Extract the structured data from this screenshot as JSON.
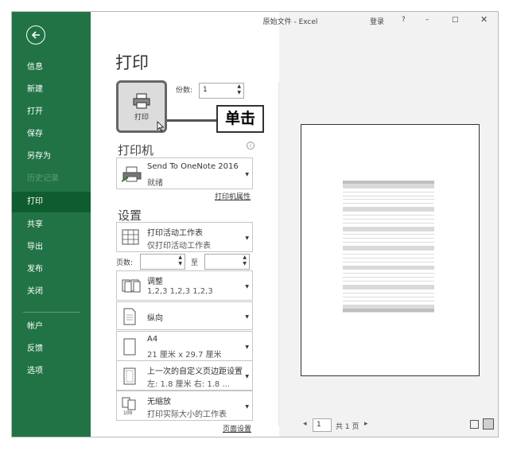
{
  "window": {
    "title": "原始文件 - Excel",
    "sign_in": "登录",
    "help": "?",
    "minimize": "–",
    "maximize": "□",
    "close": "✕"
  },
  "sidebar": {
    "items": [
      {
        "label": "信息"
      },
      {
        "label": "新建"
      },
      {
        "label": "打开"
      },
      {
        "label": "保存"
      },
      {
        "label": "另存为"
      },
      {
        "label": "历史记录"
      },
      {
        "label": "打印"
      },
      {
        "label": "共享"
      },
      {
        "label": "导出"
      },
      {
        "label": "发布"
      },
      {
        "label": "关闭"
      },
      {
        "label": "帐户"
      },
      {
        "label": "反馈"
      },
      {
        "label": "选项"
      }
    ]
  },
  "print": {
    "title": "打印",
    "button_label": "打印",
    "copies_label": "份数:",
    "copies_value": "1",
    "callout": "单击"
  },
  "printer": {
    "section_title": "打印机",
    "name": "Send To OneNote 2016",
    "status": "就绪",
    "properties_link": "打印机属性"
  },
  "settings": {
    "section_title": "设置",
    "scope_line1": "打印活动工作表",
    "scope_line2": "仅打印活动工作表",
    "pages_label": "页数:",
    "to_label": "至",
    "collate_line1": "调整",
    "collate_line2": "1,2,3    1,2,3    1,2,3",
    "orientation": "纵向",
    "paper_line1": "A4",
    "paper_line2": "21 厘米 x 29.7 厘米",
    "margins_line1": "上一次的自定义页边距设置",
    "margins_line2": "左: 1.8 厘米    右: 1.8 ...",
    "scaling_line1": "无缩放",
    "scaling_line2": "打印实际大小的工作表",
    "page_setup_link": "页面设置"
  },
  "preview": {
    "page_current": "1",
    "page_total": "共 1 页",
    "prev": "◂",
    "next": "▸"
  },
  "colors": {
    "sidebar": "#217346",
    "sidebar_active": "#0e5c2f"
  }
}
